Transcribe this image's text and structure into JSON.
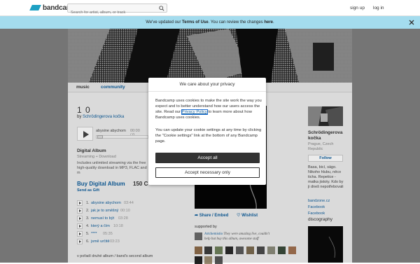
{
  "topbar": {
    "logo_text": "bandcamp",
    "search_placeholder": "Search for artist, album, or track",
    "signup_label": "sign up",
    "login_label": "log in"
  },
  "notice": {
    "prefix": "We've updated our ",
    "terms_link": "Terms of Use",
    "middle": ". You can review the changes ",
    "here_link": "here",
    "suffix": "."
  },
  "subnav": {
    "music_label": "music",
    "community_label": "community"
  },
  "album": {
    "title": "1 0",
    "by_prefix": "by",
    "artist": "Schrödingerova kočka"
  },
  "player": {
    "current_track": "abysine abychom",
    "time": "00:00 / 0"
  },
  "digital": {
    "title": "Digital Album",
    "subtitle": "Streaming + Download",
    "description": "Includes unlimited streaming via the free high-quality download in MP3, FLAC and m",
    "buy_label": "Buy Digital Album",
    "price": "150 C",
    "gift_label": "Send as Gift"
  },
  "tracks": [
    {
      "num": "1.",
      "name": "abysine abychom",
      "duration": "03:44"
    },
    {
      "num": "2.",
      "name": "jak je to směšný",
      "duration": "00:10"
    },
    {
      "num": "3.",
      "name": "nemusí to být",
      "duration": "03:28"
    },
    {
      "num": "4.",
      "name": "který a čím",
      "duration": "10:18"
    },
    {
      "num": "5.",
      "name": "****",
      "duration": "05:35"
    },
    {
      "num": "6.",
      "name": "jsmě určitě",
      "duration": "03:23"
    }
  ],
  "footer_note": "v pořadí druhé album / band's second album",
  "actions": {
    "share_label": "Share / Embed",
    "wishlist_label": "Wishlist"
  },
  "support": {
    "heading": "supported by",
    "comment_user": "Artchemistio",
    "comment_text": "They were amazing live, couldn't help but buy this album, awesome stuff"
  },
  "artist_panel": {
    "name": "Schrödingerova kočka",
    "location": "Prague, Czech Republic",
    "follow_label": "Follow",
    "bio": "Basa, bicí, sägo. Nikoho hlubu, něco ticha. Repetice - matka jistoty. Kdo by ji dneš nepotřebovali",
    "links": [
      "bandzone.cz",
      "Facebook",
      "Facebook"
    ],
    "discography_label": "discography"
  },
  "cookie_modal": {
    "title": "We care about your privacy",
    "para1_a": "Bandcamp uses cookies to make the site work the way you expect and to better understand how our users access the site. Read our ",
    "policy_link": "Privacy Policy",
    "para1_b": " to learn more about how Bandcamp uses cookies.",
    "para2": "You can update your cookie settings at any time by clicking the \"Cookie settings\" link at the bottom of any Bandcamp page.",
    "accept_all_label": "Accept all",
    "accept_necessary_label": "Accept necessary only"
  },
  "colors": {
    "brand": "#1da0c3",
    "link": "#0f5e9c",
    "notice_bg": "#a4dcee",
    "button_dark": "#333333"
  }
}
